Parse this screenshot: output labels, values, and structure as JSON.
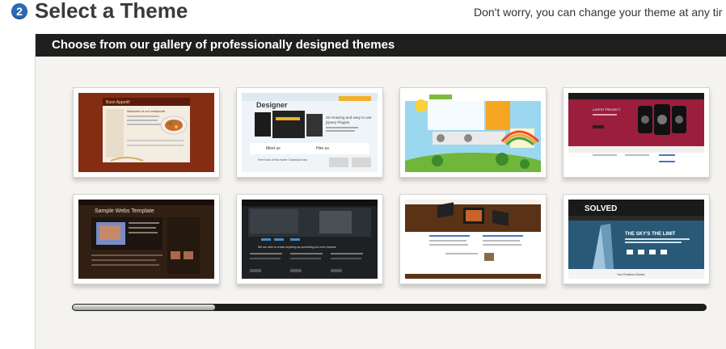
{
  "header": {
    "step_number": "2",
    "title": "Select a Theme",
    "note": "Don't worry, you can change your theme at any tir"
  },
  "panel": {
    "heading": "Choose from our gallery of professionally designed themes"
  },
  "themes": [
    {
      "texts": [
        "Buon Appetit!",
        "Welcome to our restaurant"
      ]
    },
    {
      "texts": [
        "Designer",
        "25 Amazing and easy to use",
        "jQuery Plugins",
        "Meet us",
        "Hire us",
        "Free fonts of the month: Download now"
      ]
    },
    {
      "texts": []
    },
    {
      "texts": [
        "LATEST PROJECT"
      ]
    },
    {
      "texts": [
        "Sample Webs Template"
      ]
    },
    {
      "texts": [
        "We are able to create anything as something not even dreams"
      ]
    },
    {
      "texts": []
    },
    {
      "texts": [
        "SOLVED",
        "THE SKY'S THE LIMIT",
        "Your Problems Solved"
      ]
    }
  ]
}
